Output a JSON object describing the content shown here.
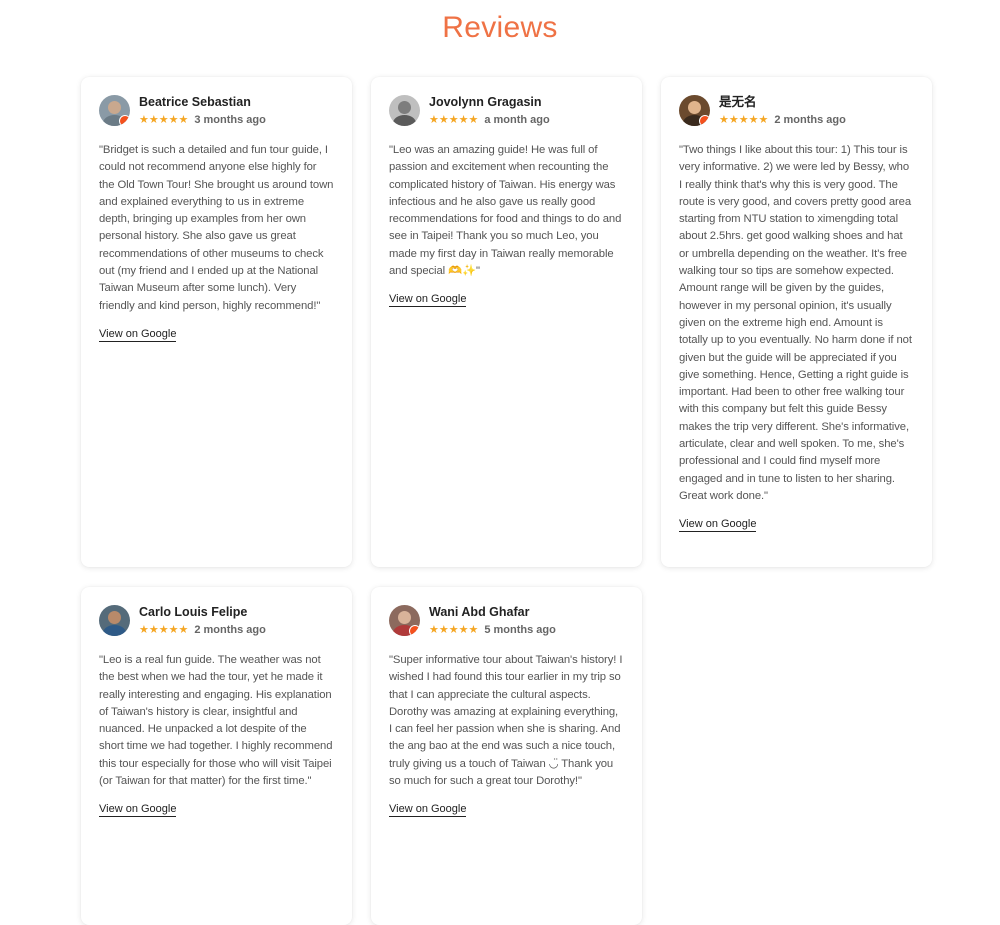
{
  "header": {
    "title": "Reviews"
  },
  "reviews": [
    {
      "name": "Beatrice Sebastian",
      "stars": "★★★★★",
      "time": "3 months ago",
      "text": "\"Bridget is such a detailed and fun tour guide, I could not recommend anyone else highly for the Old Town Tour! She brought us around town and explained everything to us in extreme depth, bringing up examples from her own personal history. She also gave us great recommendations of other museums to check out (my friend and I ended up at the National Taiwan Museum after some lunch). Very friendly and kind person, highly recommend!\"",
      "link": "View on Google",
      "avatar": {
        "bg": "#8a9aa6",
        "face": "#c9a88e",
        "body": "#6b7b86"
      }
    },
    {
      "name": "Jovolynn Gragasin",
      "stars": "★★★★★",
      "time": "a month ago",
      "text": "\"Leo was an amazing guide! He was full of passion and excitement when recounting the complicated history of Taiwan. His energy was infectious and he also gave us really good recommendations for food and things to do and see in Taipei! Thank you so much Leo, you made my first day in Taiwan really memorable and special 🫶✨\"",
      "link": "View on Google",
      "avatar": {
        "bg": "#bfbfbf",
        "face": "#7d7d7d",
        "body": "#5b5b5b"
      }
    },
    {
      "name": "是无名",
      "stars": "★★★★★",
      "time": "2 months ago",
      "text": "\"Two things I like about this tour: 1) This tour is very informative. 2) we were led by Bessy, who I really think that's why this is very good. The route is very good, and covers pretty good area starting from NTU station to ximengding total about 2.5hrs. get good walking shoes and hat or umbrella depending on the weather. It's free walking tour so tips are somehow expected. Amount range will be given by the guides, however in my personal opinion, it's usually given on the extreme high end. Amount is totally up to you eventually. No harm done if not given but the guide will be appreciated if you give something. Hence, Getting a right guide is important. Had been to other free walking tour with this company but felt this guide Bessy makes the trip very different. She's informative, articulate, clear and well spoken. To me, she's professional and I could find myself more engaged and in tune to listen to her sharing. Great work done.\"",
      "link": "View on Google",
      "avatar": {
        "bg": "#6b4a2e",
        "face": "#e0b48c",
        "body": "#3a2a1d"
      }
    },
    {
      "name": "Carlo Louis Felipe",
      "stars": "★★★★★",
      "time": "2 months ago",
      "text": "\"Leo is a real fun guide. The weather was not the best when we had the tour, yet he made it really interesting and engaging. His explanation of Taiwan's history is clear, insightful and nuanced. He unpacked a lot despite of the short time we had together. I highly recommend this tour especially for those who will visit Taipei (or Taiwan for that matter) for the first time.\"",
      "link": "View on Google",
      "avatar": {
        "bg": "#556b7a",
        "face": "#b88a6a",
        "body": "#2e5a87"
      }
    },
    {
      "name": "Wani Abd Ghafar",
      "stars": "★★★★★",
      "time": "5 months ago",
      "text": "\"Super informative tour about Taiwan's history! I wished I had found this tour earlier in my trip so that I can appreciate the cultural aspects. Dorothy was amazing at explaining everything, I can feel her passion when she is sharing. And the ang bao at the end was such a nice touch, truly giving us a touch of Taiwan ◡̈ Thank you so much for such a great tour Dorothy!\"",
      "link": "View on Google",
      "avatar": {
        "bg": "#8c6a5e",
        "face": "#d9b39a",
        "body": "#b03a3a"
      }
    }
  ]
}
